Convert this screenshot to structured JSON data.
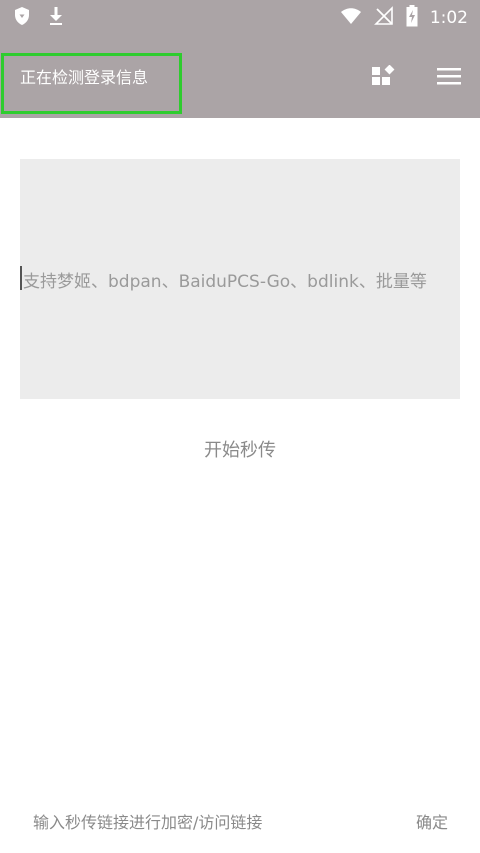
{
  "status_bar": {
    "time": "1:02",
    "left_icons": [
      "shield-icon",
      "download-icon"
    ],
    "right_icons": [
      "wifi-icon",
      "no-signal-icon",
      "battery-charging-icon"
    ]
  },
  "app_bar": {
    "title": "正在检测登录信息",
    "actions": [
      "widgets-icon",
      "menu-icon"
    ]
  },
  "input_area": {
    "placeholder": "支持梦姬、bdpan、BaiduPCS-Go、bdlink、批量等"
  },
  "start_button": {
    "label": "开始秒传"
  },
  "bottom_bar": {
    "input_placeholder": "输入秒传链接进行加密/访问链接",
    "confirm_label": "确定"
  },
  "colors": {
    "toolbar_bg": "#aba4a6",
    "highlight_border": "#2ecc2e",
    "input_bg": "#ececec",
    "text_muted": "#8a8a8a"
  }
}
